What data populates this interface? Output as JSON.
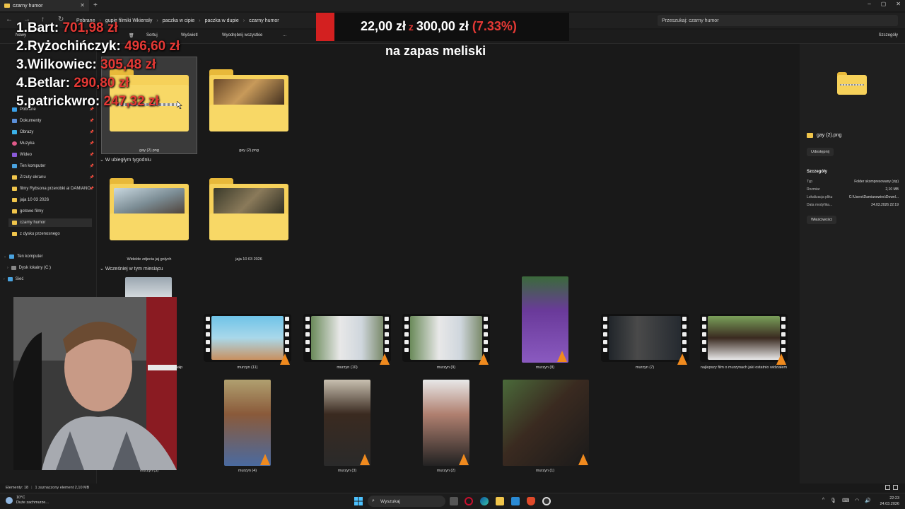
{
  "window": {
    "tab_title": "czarny humor",
    "new_tab": "+",
    "controls": [
      "–",
      "▢",
      "✕"
    ]
  },
  "address_bar": {
    "breadcrumbs": [
      "Pobrane",
      "gupie filmiki Wkiensły",
      "paczka w cipie",
      "paczka w dupie",
      "czarny humor"
    ],
    "search_placeholder": "Przeszukaj: czarny humor"
  },
  "toolbar": {
    "new_label": "Nowy",
    "sort_label": "Sortuj",
    "view_label": "Wyświetl",
    "extract_label": "Wyodrębnij wszystkie",
    "more_label": "...",
    "details_label": "Szczegóły"
  },
  "sidebar": {
    "items": [
      {
        "label": "Pobrane",
        "color": "#3aa0e8",
        "pinned": true
      },
      {
        "label": "Dokumenty",
        "color": "#5b8fd9",
        "pinned": true
      },
      {
        "label": "Obrazy",
        "color": "#3bb1e8",
        "pinned": true
      },
      {
        "label": "Muzyka",
        "color": "#e05a8a",
        "pinned": true
      },
      {
        "label": "Wideo",
        "color": "#8a5ad9",
        "pinned": true
      },
      {
        "label": "Ten komputer",
        "color": "#4aa3df",
        "pinned": true
      },
      {
        "label": "Zrzuty ekranu",
        "color": "#f0c54b",
        "pinned": true
      },
      {
        "label": "filmy Rybsona przerobki ai DAMIANO",
        "color": "#f0c54b",
        "pinned": true
      },
      {
        "label": "jaja 10 03 2026",
        "color": "#f0c54b",
        "pinned": false
      },
      {
        "label": "gotowe filmy",
        "color": "#f0c54b",
        "pinned": false
      },
      {
        "label": "czarny humor",
        "color": "#f0c54b",
        "pinned": false,
        "selected": true
      },
      {
        "label": "z dysku przenosnego",
        "color": "#f0c54b",
        "pinned": false
      }
    ],
    "tree": [
      {
        "label": "Ten komputer",
        "color": "#4aa3df"
      },
      {
        "label": "Dysk lokalny (C:)",
        "color": "#888888"
      },
      {
        "label": "Sieć",
        "color": "#4aa3df"
      }
    ]
  },
  "content": {
    "groups": {
      "last_week": "W ubiegłym tygodniu",
      "earlier_month": "Wcześniej w tym miesiącu"
    },
    "top_items": [
      {
        "label": "gay (2).png",
        "selected": true,
        "kind": "zip"
      },
      {
        "label": "gay (2).png",
        "kind": "folder"
      }
    ],
    "week_items": [
      {
        "label": "Widelde zdjecia jaj golych",
        "kind": "folder"
      },
      {
        "label": "jaja 10 03 2026",
        "kind": "folder"
      }
    ],
    "month_row1": [
      {
        "label": "nałp",
        "kind": "partial"
      },
      {
        "label": "murzyn (11)",
        "kind": "video"
      },
      {
        "label": "murzyn (10)",
        "kind": "video"
      },
      {
        "label": "murzyn (9)",
        "kind": "video"
      },
      {
        "label": "murzyn (8)",
        "kind": "portrait"
      },
      {
        "label": "murzyn (7)",
        "kind": "video"
      },
      {
        "label": "najlepszy film o murzynach jaki ostatnio widziałem",
        "kind": "video"
      }
    ],
    "month_row2": [
      {
        "label": "murzyn (5)",
        "kind": "partial"
      },
      {
        "label": "murzyn (4)",
        "kind": "portrait"
      },
      {
        "label": "murzyn (3)",
        "kind": "portrait"
      },
      {
        "label": "murzyn (2)",
        "kind": "portrait"
      },
      {
        "label": "murzyn (1)",
        "kind": "landscape"
      }
    ]
  },
  "details_pane": {
    "file_name": "gay (2).png",
    "share_label": "Udostępnij",
    "heading": "Szczegóły",
    "rows": [
      {
        "key": "Typ",
        "value": "Folder skompresowany (zip)"
      },
      {
        "key": "Rozmiar",
        "value": "2,10 MB"
      },
      {
        "key": "Lokalizacja pliku",
        "value": "C:\\Users\\Damianowiec\\Downl..."
      },
      {
        "key": "Data modyfika...",
        "value": "24.03.2026 22:19"
      }
    ],
    "properties_label": "Właściwości"
  },
  "status_bar": {
    "count": "Elementy: 18",
    "selection": "1 zaznaczony element  2,10 MB"
  },
  "taskbar": {
    "weather_temp": "10°C",
    "weather_desc": "Duże zachmurze...",
    "search_label": "Wyszukaj",
    "time": "22:23",
    "date": "24.03.2026"
  },
  "overlay": {
    "leaderboard": [
      {
        "name": "1.Bart: ",
        "amount": "701,98 zł"
      },
      {
        "name": "2.Ryżochińczyk: ",
        "amount": "496,60 zł"
      },
      {
        "name": "3.Wilkowiec: ",
        "amount": "305,48 zł"
      },
      {
        "name": "4.Betlar: ",
        "amount": "290,80 zł"
      },
      {
        "name": "5.patrickwro: ",
        "amount": "247,32 zł"
      }
    ],
    "donation_current": "22,00 zł",
    "donation_sep": " z ",
    "donation_goal": "300,00 zł",
    "donation_pct": " (7.33%)",
    "goal_caption": "na zapas meliski",
    "progress_fraction": 0.0733
  },
  "colors": {
    "accent_red": "#e53935",
    "folder_yellow": "#f6d15a",
    "background": "#191919"
  }
}
